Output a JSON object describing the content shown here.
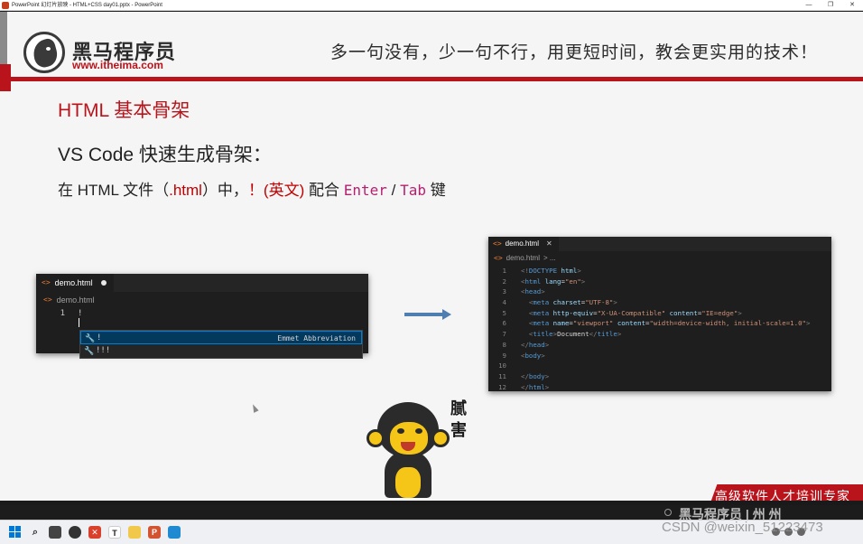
{
  "window": {
    "title": "PowerPoint 幻灯片放映  -  HTML+CSS day01.pptx  -  PowerPoint",
    "minimize_glyph": "—",
    "restore_glyph": "❐",
    "close_glyph": "✕"
  },
  "slide": {
    "brand_name": "黑马程序员",
    "brand_url": "www.itheima.com",
    "slogan": "多一句没有，少一句不行，用更短时间，教会更实用的技术！",
    "heading": "HTML 基本骨架",
    "subheading": "VS Code 快速生成骨架：",
    "instruction": {
      "prefix": "在 HTML 文件（",
      "ext": ".html",
      "mid1": "）中，",
      "bang": "！(英文)",
      "mid2": " 配合 ",
      "enter": "Enter",
      "slash": " / ",
      "tab": "Tab",
      "suffix": " 键"
    },
    "mascot_text": "腻害",
    "banner": "高级软件人才培训专家"
  },
  "editor_left": {
    "tab_label": "demo.html",
    "breadcrumb": "demo.html",
    "line_number": "1",
    "line_text": "!",
    "suggestions": [
      {
        "label": "!",
        "detail": "Emmet Abbreviation"
      },
      {
        "label": "!!!",
        "detail": ""
      }
    ]
  },
  "editor_right": {
    "tab_label": "demo.html",
    "close_glyph": "✕",
    "breadcrumb": "demo.html",
    "breadcrumb_more": "> ...",
    "lines": [
      {
        "num": "1",
        "indent": "",
        "parts": [
          [
            "br",
            "<!"
          ],
          [
            "tag",
            "DOCTYPE "
          ],
          [
            "attr",
            "html"
          ],
          [
            "br",
            ">"
          ]
        ]
      },
      {
        "num": "2",
        "indent": "",
        "parts": [
          [
            "br",
            "<"
          ],
          [
            "tag",
            "html "
          ],
          [
            "attr",
            "lang"
          ],
          [
            "txt",
            "="
          ],
          [
            "val",
            "\"en\""
          ],
          [
            "br",
            ">"
          ]
        ]
      },
      {
        "num": "3",
        "indent": "",
        "parts": [
          [
            "br",
            "<"
          ],
          [
            "tag",
            "head"
          ],
          [
            "br",
            ">"
          ]
        ]
      },
      {
        "num": "4",
        "indent": "  ",
        "parts": [
          [
            "br",
            "<"
          ],
          [
            "tag",
            "meta "
          ],
          [
            "attr",
            "charset"
          ],
          [
            "txt",
            "="
          ],
          [
            "val",
            "\"UTF-8\""
          ],
          [
            "br",
            ">"
          ]
        ]
      },
      {
        "num": "5",
        "indent": "  ",
        "parts": [
          [
            "br",
            "<"
          ],
          [
            "tag",
            "meta "
          ],
          [
            "attr",
            "http-equiv"
          ],
          [
            "txt",
            "="
          ],
          [
            "val",
            "\"X-UA-Compatible\""
          ],
          [
            "txt",
            " "
          ],
          [
            "attr",
            "content"
          ],
          [
            "txt",
            "="
          ],
          [
            "val",
            "\"IE=edge\""
          ],
          [
            "br",
            ">"
          ]
        ]
      },
      {
        "num": "6",
        "indent": "  ",
        "parts": [
          [
            "br",
            "<"
          ],
          [
            "tag",
            "meta "
          ],
          [
            "attr",
            "name"
          ],
          [
            "txt",
            "="
          ],
          [
            "val",
            "\"viewport\""
          ],
          [
            "txt",
            " "
          ],
          [
            "attr",
            "content"
          ],
          [
            "txt",
            "="
          ],
          [
            "val",
            "\"width=device-width, initial-scale=1.0\""
          ],
          [
            "br",
            ">"
          ]
        ]
      },
      {
        "num": "7",
        "indent": "  ",
        "parts": [
          [
            "br",
            "<"
          ],
          [
            "tag",
            "title"
          ],
          [
            "br",
            ">"
          ],
          [
            "txt",
            "Document"
          ],
          [
            "br",
            "</"
          ],
          [
            "tag",
            "title"
          ],
          [
            "br",
            ">"
          ]
        ]
      },
      {
        "num": "8",
        "indent": "",
        "parts": [
          [
            "br",
            "</"
          ],
          [
            "tag",
            "head"
          ],
          [
            "br",
            ">"
          ]
        ]
      },
      {
        "num": "9",
        "indent": "",
        "parts": [
          [
            "br",
            "<"
          ],
          [
            "tag",
            "body"
          ],
          [
            "br",
            ">"
          ]
        ]
      },
      {
        "num": "10",
        "indent": "",
        "parts": []
      },
      {
        "num": "11",
        "indent": "",
        "parts": [
          [
            "br",
            "</"
          ],
          [
            "tag",
            "body"
          ],
          [
            "br",
            ">"
          ]
        ]
      },
      {
        "num": "12",
        "indent": "",
        "parts": [
          [
            "br",
            "</"
          ],
          [
            "tag",
            "html"
          ],
          [
            "br",
            ">"
          ]
        ]
      }
    ]
  },
  "status_strip": {
    "logo_text": "黑马程序员 | 州 州"
  },
  "taskbar": {
    "watermark": "CSDN @weixin_51223473",
    "tray_time": "",
    "icons": [
      "windows-icon",
      "search-icon",
      "task-view-icon",
      "chrome-icon",
      "xmind-icon",
      "typora-icon",
      "file-explorer-icon",
      "powerpoint-icon",
      "vscode-icon"
    ]
  },
  "colors": {
    "accent_red": "#b9141c",
    "vscode_bg": "#1e1e1e",
    "arrow_blue": "#4f7fb0",
    "mascot_yellow": "#f5c518"
  }
}
